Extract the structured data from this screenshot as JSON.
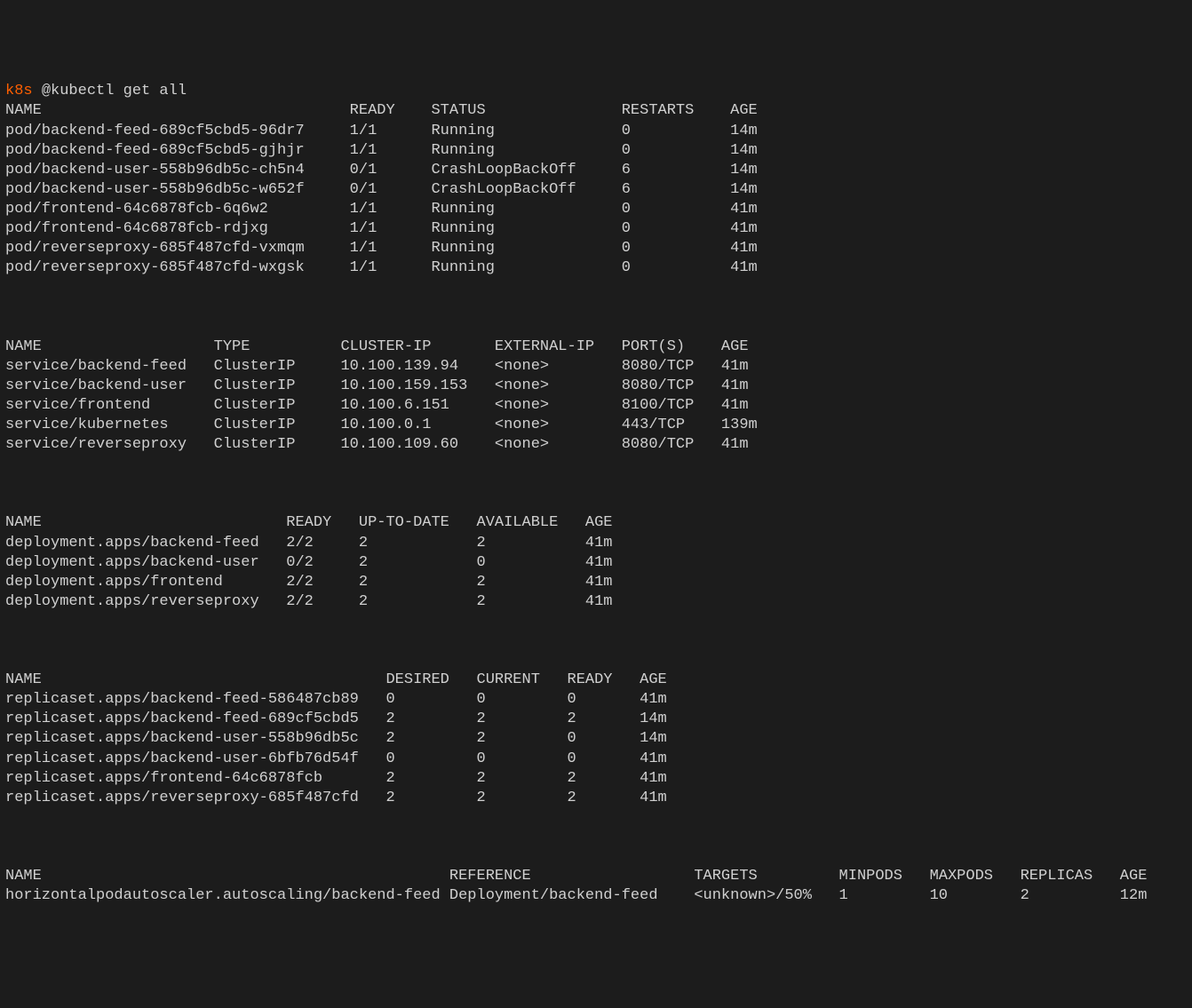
{
  "prompt": {
    "context": "k8s",
    "symbol": "@",
    "command": "kubectl get all"
  },
  "pods": {
    "headers": [
      "NAME",
      "READY",
      "STATUS",
      "RESTARTS",
      "AGE"
    ],
    "widths": [
      38,
      9,
      21,
      12,
      6
    ],
    "rows": [
      [
        "pod/backend-feed-689cf5cbd5-96dr7",
        "1/1",
        "Running",
        "0",
        "14m"
      ],
      [
        "pod/backend-feed-689cf5cbd5-gjhjr",
        "1/1",
        "Running",
        "0",
        "14m"
      ],
      [
        "pod/backend-user-558b96db5c-ch5n4",
        "0/1",
        "CrashLoopBackOff",
        "6",
        "14m"
      ],
      [
        "pod/backend-user-558b96db5c-w652f",
        "0/1",
        "CrashLoopBackOff",
        "6",
        "14m"
      ],
      [
        "pod/frontend-64c6878fcb-6q6w2",
        "1/1",
        "Running",
        "0",
        "41m"
      ],
      [
        "pod/frontend-64c6878fcb-rdjxg",
        "1/1",
        "Running",
        "0",
        "41m"
      ],
      [
        "pod/reverseproxy-685f487cfd-vxmqm",
        "1/1",
        "Running",
        "0",
        "41m"
      ],
      [
        "pod/reverseproxy-685f487cfd-wxgsk",
        "1/1",
        "Running",
        "0",
        "41m"
      ]
    ]
  },
  "services": {
    "headers": [
      "NAME",
      "TYPE",
      "CLUSTER-IP",
      "EXTERNAL-IP",
      "PORT(S)",
      "AGE"
    ],
    "widths": [
      23,
      14,
      17,
      14,
      11,
      6
    ],
    "rows": [
      [
        "service/backend-feed",
        "ClusterIP",
        "10.100.139.94",
        "<none>",
        "8080/TCP",
        "41m"
      ],
      [
        "service/backend-user",
        "ClusterIP",
        "10.100.159.153",
        "<none>",
        "8080/TCP",
        "41m"
      ],
      [
        "service/frontend",
        "ClusterIP",
        "10.100.6.151",
        "<none>",
        "8100/TCP",
        "41m"
      ],
      [
        "service/kubernetes",
        "ClusterIP",
        "10.100.0.1",
        "<none>",
        "443/TCP",
        "139m"
      ],
      [
        "service/reverseproxy",
        "ClusterIP",
        "10.100.109.60",
        "<none>",
        "8080/TCP",
        "41m"
      ]
    ]
  },
  "deployments": {
    "headers": [
      "NAME",
      "READY",
      "UP-TO-DATE",
      "AVAILABLE",
      "AGE"
    ],
    "widths": [
      31,
      8,
      13,
      12,
      6
    ],
    "rows": [
      [
        "deployment.apps/backend-feed",
        "2/2",
        "2",
        "2",
        "41m"
      ],
      [
        "deployment.apps/backend-user",
        "0/2",
        "2",
        "0",
        "41m"
      ],
      [
        "deployment.apps/frontend",
        "2/2",
        "2",
        "2",
        "41m"
      ],
      [
        "deployment.apps/reverseproxy",
        "2/2",
        "2",
        "2",
        "41m"
      ]
    ]
  },
  "replicasets": {
    "headers": [
      "NAME",
      "DESIRED",
      "CURRENT",
      "READY",
      "AGE"
    ],
    "widths": [
      42,
      10,
      10,
      8,
      6
    ],
    "rows": [
      [
        "replicaset.apps/backend-feed-586487cb89",
        "0",
        "0",
        "0",
        "41m"
      ],
      [
        "replicaset.apps/backend-feed-689cf5cbd5",
        "2",
        "2",
        "2",
        "14m"
      ],
      [
        "replicaset.apps/backend-user-558b96db5c",
        "2",
        "2",
        "0",
        "14m"
      ],
      [
        "replicaset.apps/backend-user-6bfb76d54f",
        "0",
        "0",
        "0",
        "41m"
      ],
      [
        "replicaset.apps/frontend-64c6878fcb",
        "2",
        "2",
        "2",
        "41m"
      ],
      [
        "replicaset.apps/reverseproxy-685f487cfd",
        "2",
        "2",
        "2",
        "41m"
      ]
    ]
  },
  "hpa": {
    "headers": [
      "NAME",
      "REFERENCE",
      "TARGETS",
      "MINPODS",
      "MAXPODS",
      "REPLICAS",
      "AGE"
    ],
    "widths": [
      49,
      27,
      16,
      10,
      10,
      11,
      5
    ],
    "rows": [
      [
        "horizontalpodautoscaler.autoscaling/backend-feed",
        "Deployment/backend-feed",
        "<unknown>/50%",
        "1",
        "10",
        "2",
        "12m"
      ]
    ]
  }
}
